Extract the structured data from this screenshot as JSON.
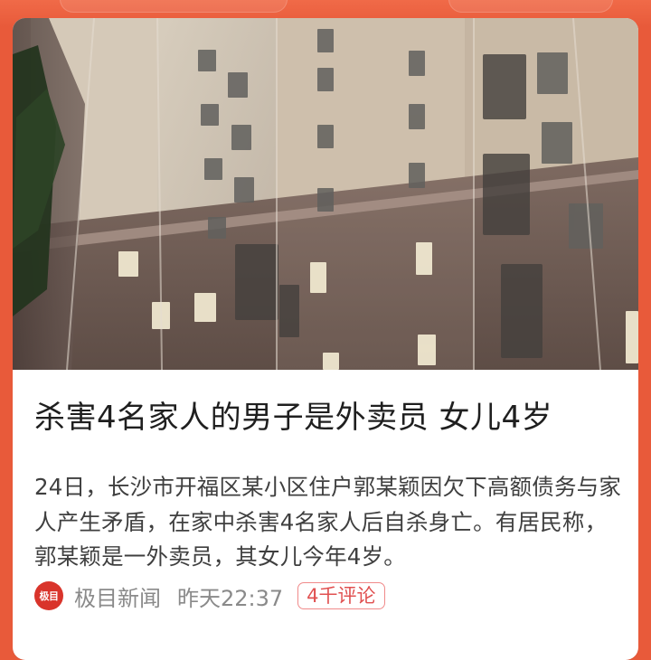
{
  "colors": {
    "background": "#e85a3a",
    "card": "#ffffff",
    "headline": "#1f1f1f",
    "summary": "#3f3f3f",
    "meta": "#8a8a8a",
    "comment_badge": "#e05050",
    "source_logo": "#d9342b"
  },
  "article": {
    "image": "apartment-building-photo",
    "headline": "杀害4名家人的男子是外卖员 女儿4岁",
    "summary": "24日，长沙市开福区某小区住户郭某颖因欠下高额债务与家人产生矛盾，在家中杀害4名家人后自杀身亡。有居民称，郭某颖是一外卖员，其女儿今年4岁。",
    "source_logo": "极目",
    "source": "极目新闻",
    "time": "昨天22:37",
    "comments": "4千评论"
  }
}
